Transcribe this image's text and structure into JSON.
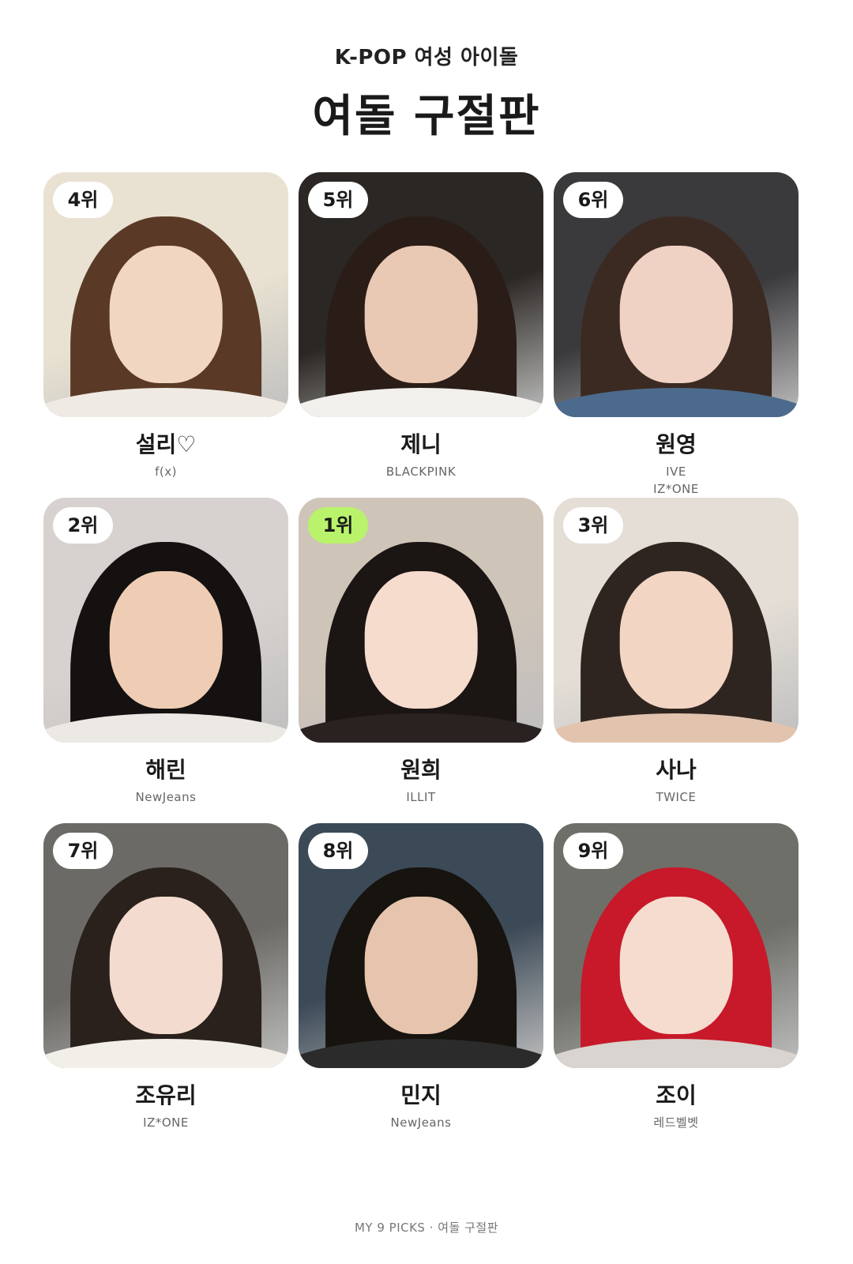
{
  "header": {
    "subtitle": "K-POP 여성 아이돌",
    "title": "여돌 구절판"
  },
  "cards": [
    {
      "rank": "4위",
      "name": "설리♡",
      "group": "f(x)",
      "bg": "#e9e2d2",
      "hair": "#5a3a26",
      "skin": "#f1d6c2",
      "top": "#efeae3"
    },
    {
      "rank": "5위",
      "name": "제니",
      "group": "BLACKPINK",
      "bg": "#2b2724",
      "hair": "#2a1d17",
      "skin": "#e9c8b4",
      "top": "#f2f0ec"
    },
    {
      "rank": "6위",
      "name": "원영",
      "group": "IVE\nIZ*ONE",
      "bg": "#3a3a3d",
      "hair": "#3b2a22",
      "skin": "#f0d2c4",
      "top": "#4c6a8c"
    },
    {
      "rank": "2위",
      "name": "해린",
      "group": "NewJeans",
      "bg": "#d7d2cf",
      "hair": "#141110",
      "skin": "#efcdb4",
      "top": "#ece8e4"
    },
    {
      "rank": "1위",
      "name": "원희",
      "group": "ILLIT",
      "bg": "#cfc4b8",
      "hair": "#1b1513",
      "skin": "#f6dccd",
      "top": "#2a2220",
      "first": true
    },
    {
      "rank": "3위",
      "name": "사나",
      "group": "TWICE",
      "bg": "#e4ded6",
      "hair": "#2f2520",
      "skin": "#f2d5c3",
      "top": "#e2c4ae"
    },
    {
      "rank": "7위",
      "name": "조유리",
      "group": "IZ*ONE",
      "bg": "#6b6a66",
      "hair": "#2a201c",
      "skin": "#f3dccf",
      "top": "#f2efe9"
    },
    {
      "rank": "8위",
      "name": "민지",
      "group": "NewJeans",
      "bg": "#3c4a57",
      "hair": "#17130f",
      "skin": "#e6c4ad",
      "top": "#2b2b2b"
    },
    {
      "rank": "9위",
      "name": "조이",
      "group": "레드벨벳",
      "bg": "#6f6f69",
      "hair": "#c7192a",
      "skin": "#f6dccf",
      "top": "#d9d4cf"
    }
  ],
  "footer": {
    "text": "MY 9 PICKS · 여돌 구절판"
  },
  "colors": {
    "accent": "#b9f36b"
  }
}
